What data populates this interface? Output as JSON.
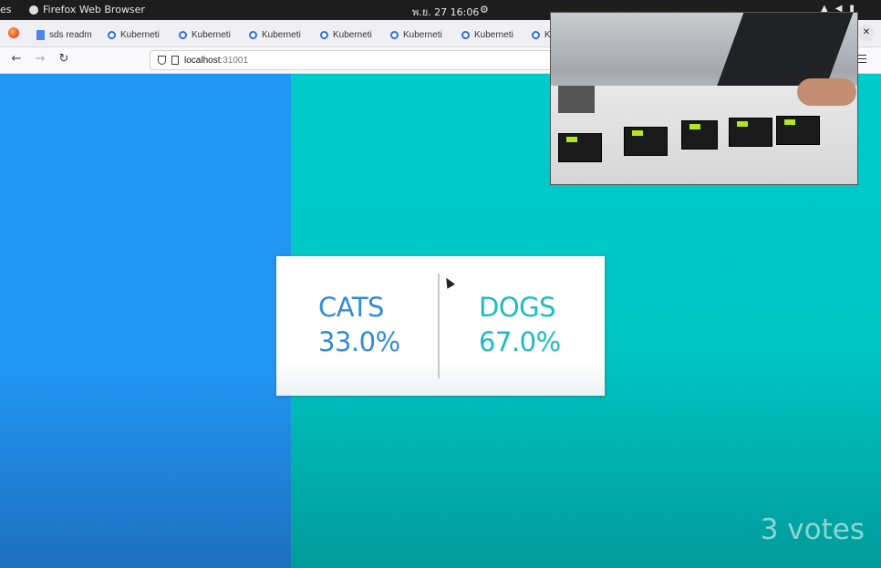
{
  "topbar": {
    "activities_label": "es",
    "app_name": "Firefox Web Browser",
    "clock": "พ.ย. 27  16:06"
  },
  "tabs": [
    {
      "label": "sds readm",
      "icon": "doc-icon"
    },
    {
      "label": "Kuberneti",
      "icon": "kubernetes-icon"
    },
    {
      "label": "Kuberneti",
      "icon": "kubernetes-icon"
    },
    {
      "label": "Kuberneti",
      "icon": "kubernetes-icon"
    },
    {
      "label": "Kuberneti",
      "icon": "kubernetes-icon"
    },
    {
      "label": "Kuberneti",
      "icon": "kubernetes-icon"
    },
    {
      "label": "Kuberneti",
      "icon": "kubernetes-icon"
    },
    {
      "label": "K",
      "icon": "kubernetes-icon"
    }
  ],
  "navbar": {
    "url_host": "localhost",
    "url_port": ":31001"
  },
  "results": {
    "option_a": {
      "label": "CATS",
      "percent": "33.0%",
      "color": "#2196f3"
    },
    "option_b": {
      "label": "DOGS",
      "percent": "67.0%",
      "color": "#00cbca"
    },
    "split_fraction_a": 0.33,
    "votes": "3 votes"
  }
}
